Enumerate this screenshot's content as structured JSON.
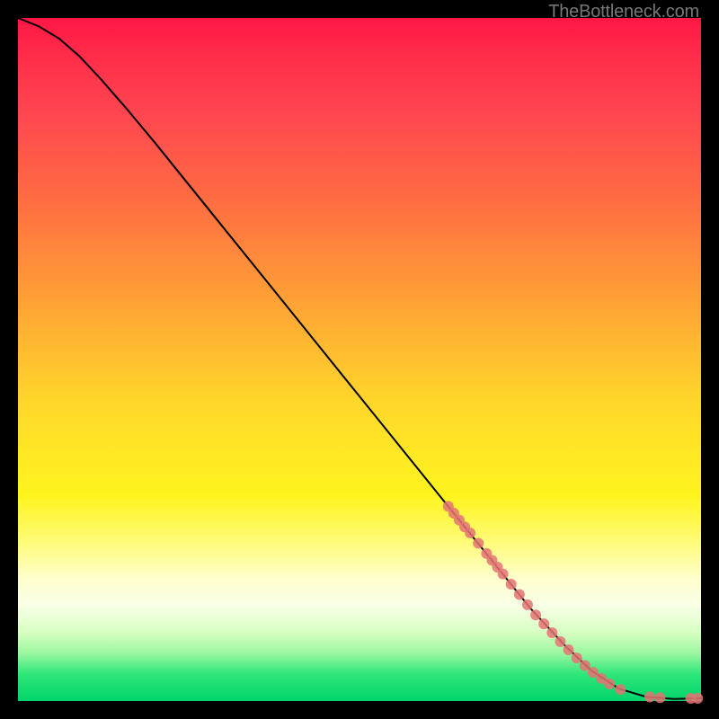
{
  "attribution": "TheBottleneck.com",
  "chart_data": {
    "type": "line",
    "title": "",
    "xlabel": "",
    "ylabel": "",
    "xlim": [
      0,
      100
    ],
    "ylim": [
      0,
      100
    ],
    "curve": [
      {
        "x": 0,
        "y": 100.0
      },
      {
        "x": 3,
        "y": 98.8
      },
      {
        "x": 6,
        "y": 97.0
      },
      {
        "x": 9,
        "y": 94.4
      },
      {
        "x": 12,
        "y": 91.2
      },
      {
        "x": 16,
        "y": 86.6
      },
      {
        "x": 20,
        "y": 81.8
      },
      {
        "x": 25,
        "y": 75.6
      },
      {
        "x": 30,
        "y": 69.4
      },
      {
        "x": 35,
        "y": 63.2
      },
      {
        "x": 40,
        "y": 57.0
      },
      {
        "x": 45,
        "y": 50.8
      },
      {
        "x": 50,
        "y": 44.6
      },
      {
        "x": 55,
        "y": 38.4
      },
      {
        "x": 60,
        "y": 32.2
      },
      {
        "x": 65,
        "y": 26.0
      },
      {
        "x": 70,
        "y": 19.8
      },
      {
        "x": 75,
        "y": 13.6
      },
      {
        "x": 80,
        "y": 8.2
      },
      {
        "x": 84,
        "y": 4.4
      },
      {
        "x": 88,
        "y": 1.8
      },
      {
        "x": 92,
        "y": 0.6
      },
      {
        "x": 96,
        "y": 0.3
      },
      {
        "x": 100,
        "y": 0.4
      }
    ],
    "data_points": [
      {
        "x": 63.0,
        "y": 28.5
      },
      {
        "x": 63.8,
        "y": 27.5
      },
      {
        "x": 64.6,
        "y": 26.5
      },
      {
        "x": 65.4,
        "y": 25.5
      },
      {
        "x": 66.2,
        "y": 24.6
      },
      {
        "x": 67.4,
        "y": 23.1
      },
      {
        "x": 68.6,
        "y": 21.6
      },
      {
        "x": 69.4,
        "y": 20.6
      },
      {
        "x": 70.2,
        "y": 19.6
      },
      {
        "x": 71.0,
        "y": 18.6
      },
      {
        "x": 72.2,
        "y": 17.1
      },
      {
        "x": 73.4,
        "y": 15.6
      },
      {
        "x": 74.6,
        "y": 14.1
      },
      {
        "x": 75.8,
        "y": 12.6
      },
      {
        "x": 77.0,
        "y": 11.3
      },
      {
        "x": 78.2,
        "y": 10.0
      },
      {
        "x": 79.4,
        "y": 8.7
      },
      {
        "x": 80.6,
        "y": 7.5
      },
      {
        "x": 81.8,
        "y": 6.3
      },
      {
        "x": 83.0,
        "y": 5.2
      },
      {
        "x": 84.2,
        "y": 4.2
      },
      {
        "x": 85.4,
        "y": 3.3
      },
      {
        "x": 86.6,
        "y": 2.5
      },
      {
        "x": 88.2,
        "y": 1.7
      },
      {
        "x": 92.5,
        "y": 0.6
      },
      {
        "x": 94.0,
        "y": 0.5
      },
      {
        "x": 98.5,
        "y": 0.4
      },
      {
        "x": 99.5,
        "y": 0.4
      }
    ],
    "dot_color": "#e57373",
    "dot_radius": 6
  }
}
